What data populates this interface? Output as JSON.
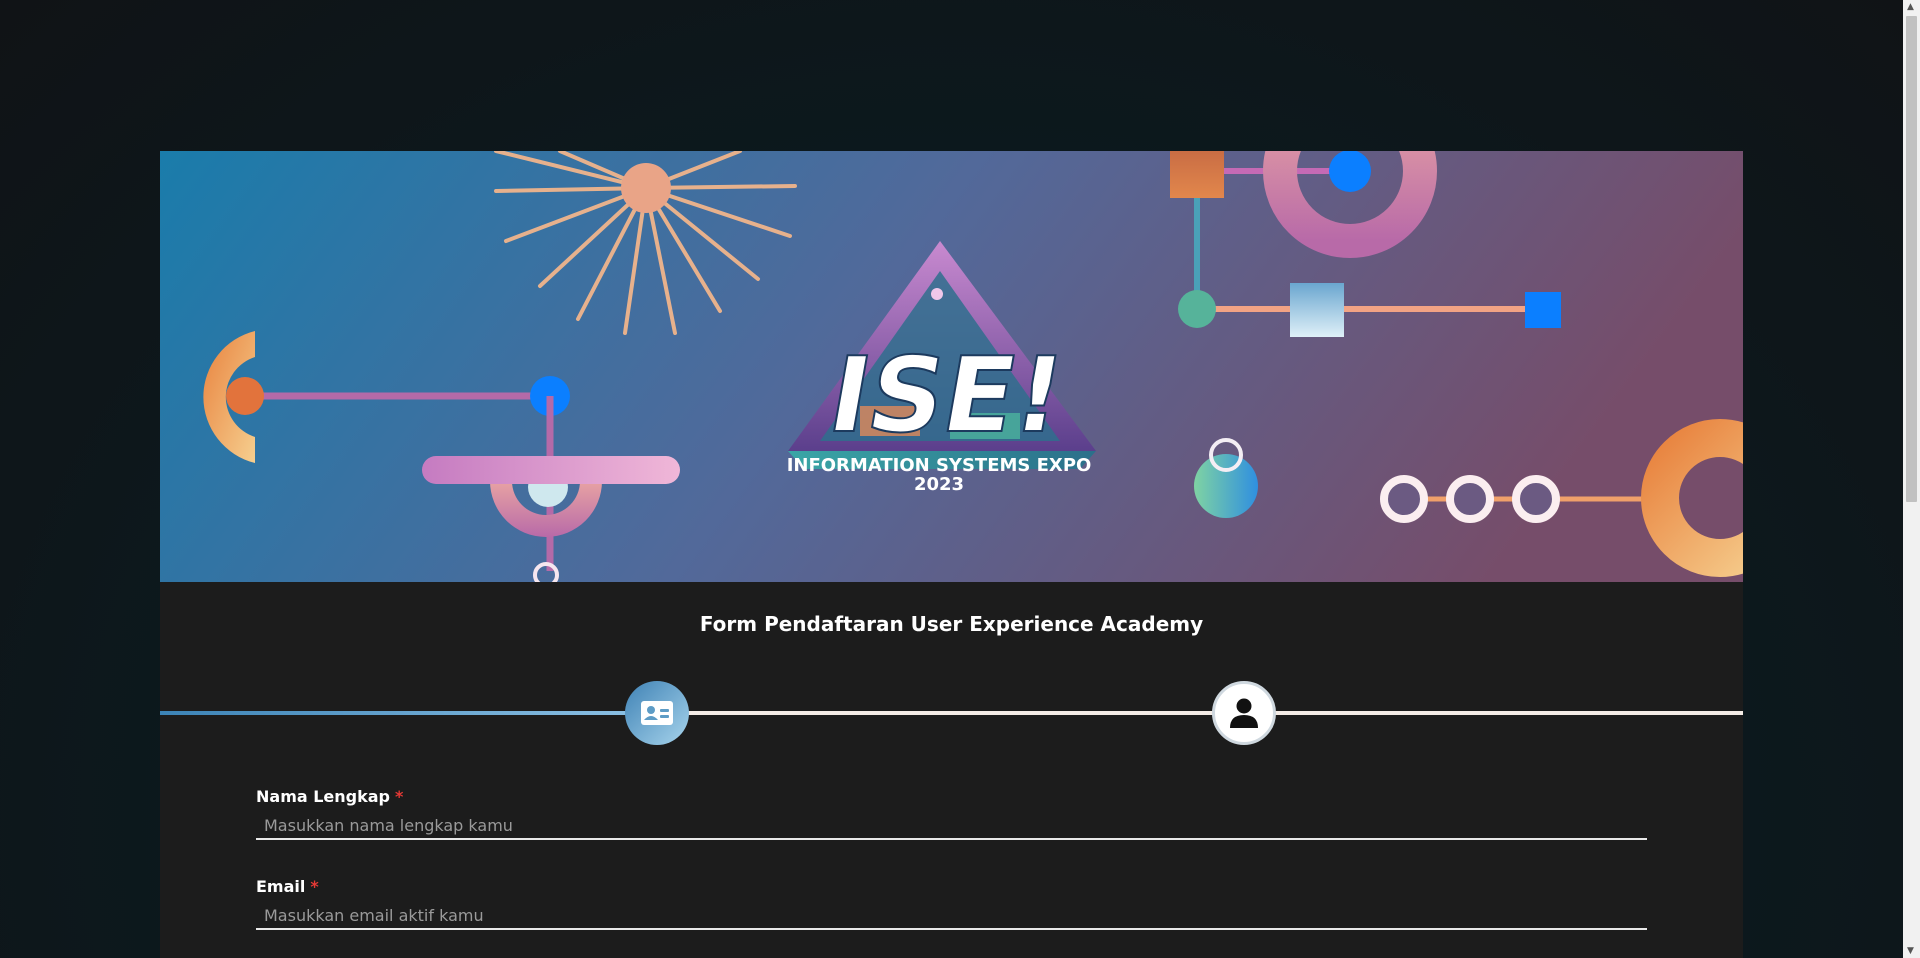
{
  "banner": {
    "logo_text": "ISE!",
    "event_name": "INFORMATION SYSTEMS EXPO",
    "event_year": "2023"
  },
  "form": {
    "title": "Form Pendaftaran User Experience Academy",
    "required_marker": "*",
    "fields": [
      {
        "label": "Nama Lengkap",
        "placeholder": "Masukkan nama lengkap kamu",
        "value": ""
      },
      {
        "label": "Email",
        "placeholder": "Masukkan email aktif kamu",
        "value": ""
      }
    ]
  },
  "stepper": {
    "current_step": 1,
    "steps": [
      {
        "icon": "id-card-icon",
        "state": "active"
      },
      {
        "icon": "user-icon",
        "state": "pending"
      }
    ]
  },
  "colors": {
    "card_background": "#1c1c1c",
    "step_active": "#3f82b5",
    "required": "#e53935",
    "banner_start": "#1a7cab",
    "banner_end": "#744c6b"
  }
}
